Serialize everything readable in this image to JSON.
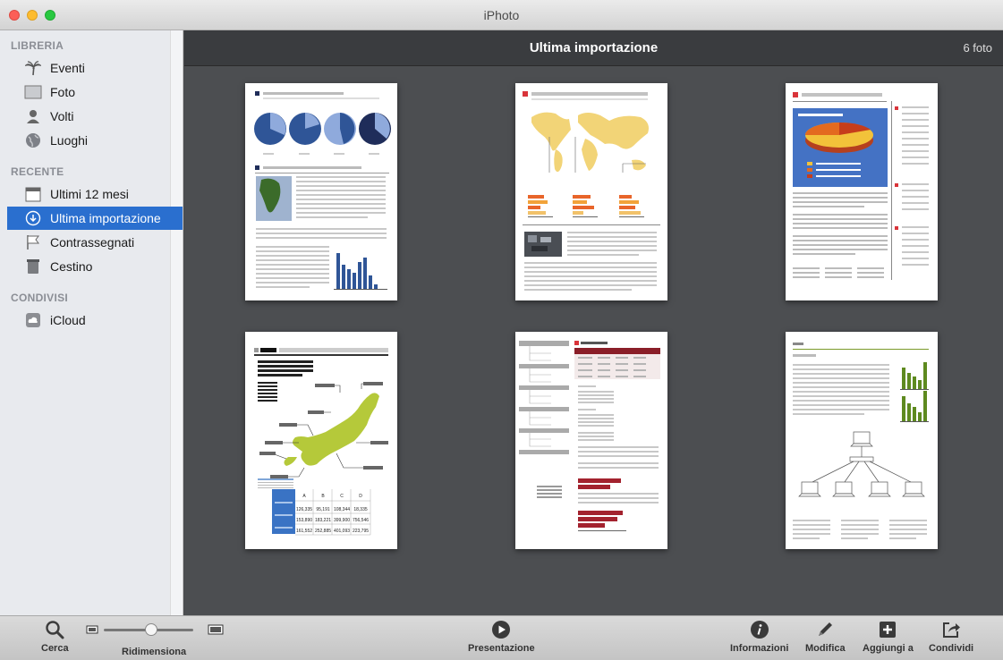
{
  "window": {
    "title": "iPhoto"
  },
  "sidebar": {
    "sections": [
      {
        "label": "LIBRERIA",
        "items": [
          {
            "label": "Eventi",
            "icon": "palm-tree-icon"
          },
          {
            "label": "Foto",
            "icon": "photo-icon"
          },
          {
            "label": "Volti",
            "icon": "person-icon"
          },
          {
            "label": "Luoghi",
            "icon": "globe-icon"
          }
        ]
      },
      {
        "label": "RECENTE",
        "items": [
          {
            "label": "Ultimi 12 mesi",
            "icon": "calendar-icon"
          },
          {
            "label": "Ultima importazione",
            "icon": "import-icon",
            "selected": true
          },
          {
            "label": "Contrassegnati",
            "icon": "flag-icon"
          },
          {
            "label": "Cestino",
            "icon": "trash-icon"
          }
        ]
      },
      {
        "label": "CONDIVISI",
        "items": [
          {
            "label": "iCloud",
            "icon": "cloud-icon"
          }
        ]
      }
    ]
  },
  "main": {
    "title": "Ultima importazione",
    "count": "6 foto",
    "thumb_d": {
      "cols": [
        "A",
        "B",
        "C",
        "D"
      ],
      "rows": [
        [
          "126,335",
          "95,191",
          "108,344",
          "18,335"
        ],
        [
          "153,890",
          "183,221",
          "399,900",
          "756,546"
        ],
        [
          "161,552",
          "252,885",
          "401,093",
          "223,795"
        ]
      ]
    }
  },
  "toolbar": {
    "search": "Cerca",
    "resize": "Ridimensiona",
    "slideshow": "Presentazione",
    "info": "Informazioni",
    "edit": "Modifica",
    "add": "Aggiungi a",
    "share": "Condividi"
  },
  "colors": {
    "accent": "#2a6fcf",
    "main_bg": "#4c4e51",
    "sidebar_bg": "#e8eaee"
  }
}
